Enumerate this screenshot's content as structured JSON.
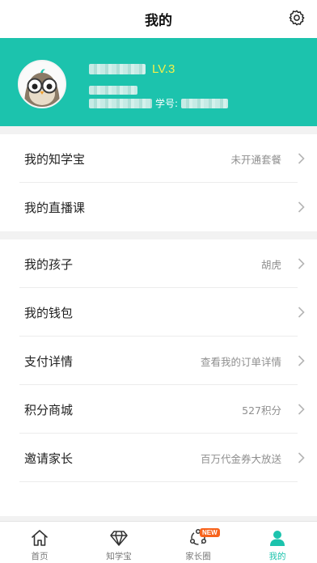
{
  "topbar": {
    "title": "我的"
  },
  "profile": {
    "level": "LV.3",
    "id_label": "学号:"
  },
  "section1": [
    {
      "label": "我的知学宝",
      "value": "未开通套餐"
    },
    {
      "label": "我的直播课",
      "value": ""
    }
  ],
  "section2": [
    {
      "label": "我的孩子",
      "value": "胡虎"
    },
    {
      "label": "我的钱包",
      "value": ""
    },
    {
      "label": "支付详情",
      "value": "查看我的订单详情"
    },
    {
      "label": "积分商城",
      "value": "527积分"
    },
    {
      "label": "邀请家长",
      "value": "百万代金券大放送"
    }
  ],
  "tabs": [
    {
      "label": "首页",
      "icon": "home-icon"
    },
    {
      "label": "知学宝",
      "icon": "diamond-icon"
    },
    {
      "label": "家长圈",
      "icon": "circle-icon",
      "badge": "NEW"
    },
    {
      "label": "我的",
      "icon": "person-icon"
    }
  ],
  "colors": {
    "accent": "#1cc3ad",
    "level": "#f2f04a",
    "badge": "#f7631c"
  }
}
